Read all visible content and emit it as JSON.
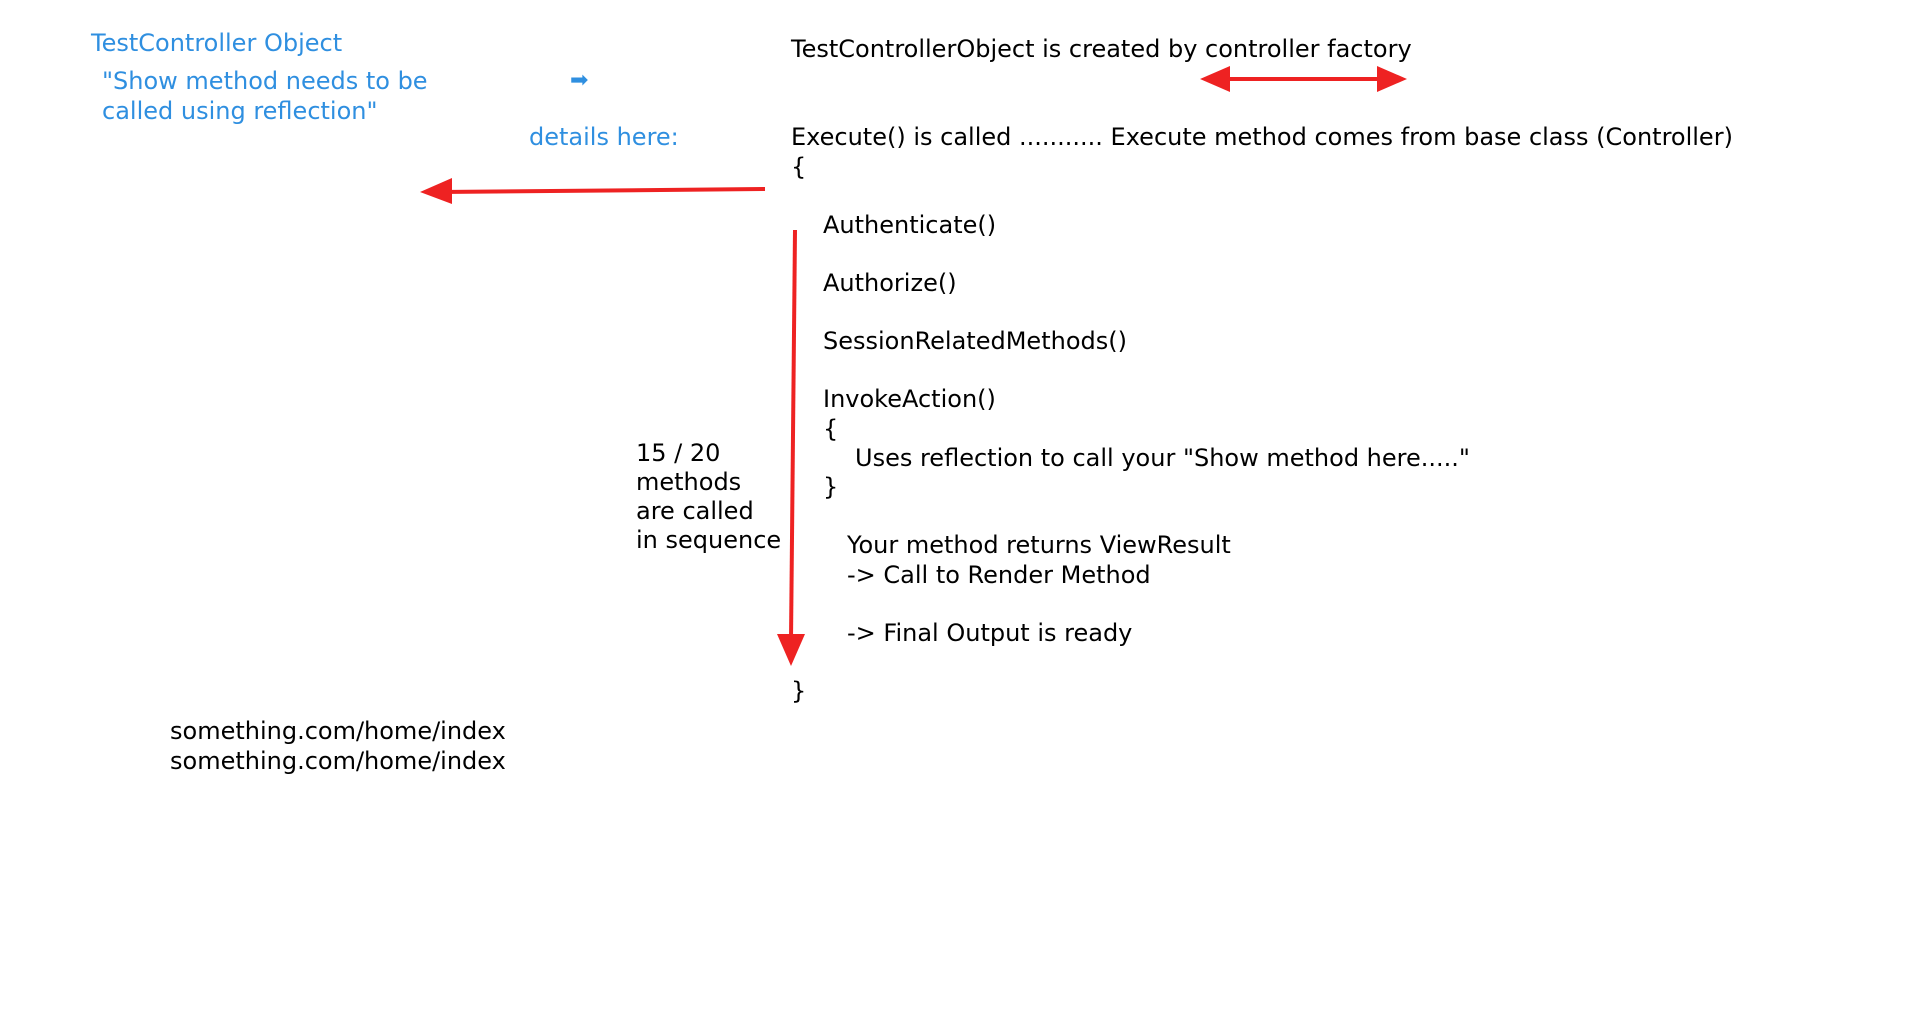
{
  "left_notes": {
    "title": "TestController Object",
    "quote_line1": "\"Show method needs to be",
    "quote_line2": "called using reflection\"",
    "details": "details here:",
    "right_arrow_glyph": "➡"
  },
  "flow": {
    "created_line": "TestControllerObject is created by controller factory",
    "execute_line": "Execute() is called ........... Execute method comes from base class (Controller)",
    "open_brace": "{",
    "authenticate": "Authenticate()",
    "authorize": "Authorize()",
    "session_methods": "SessionRelatedMethods()",
    "invoke_action": "InvokeAction()",
    "invoke_open": "{",
    "reflection_line": "Uses reflection to call your \"Show method here.....\"",
    "invoke_close": "}",
    "returns_line": "Your method returns ViewResult",
    "render_line": "-> Call to Render Method",
    "final_line": "-> Final Output is ready",
    "close_brace": "}"
  },
  "sequence_note": {
    "line1": "15 / 20",
    "line2": "methods",
    "line3": "are called",
    "line4": "in sequence"
  },
  "urls": {
    "line1": "something.com/home/index",
    "line2": "something.com/home/index"
  },
  "colors": {
    "annotation_blue": "#2f8fe0",
    "arrow_red": "#ee2222",
    "text": "#000000"
  }
}
